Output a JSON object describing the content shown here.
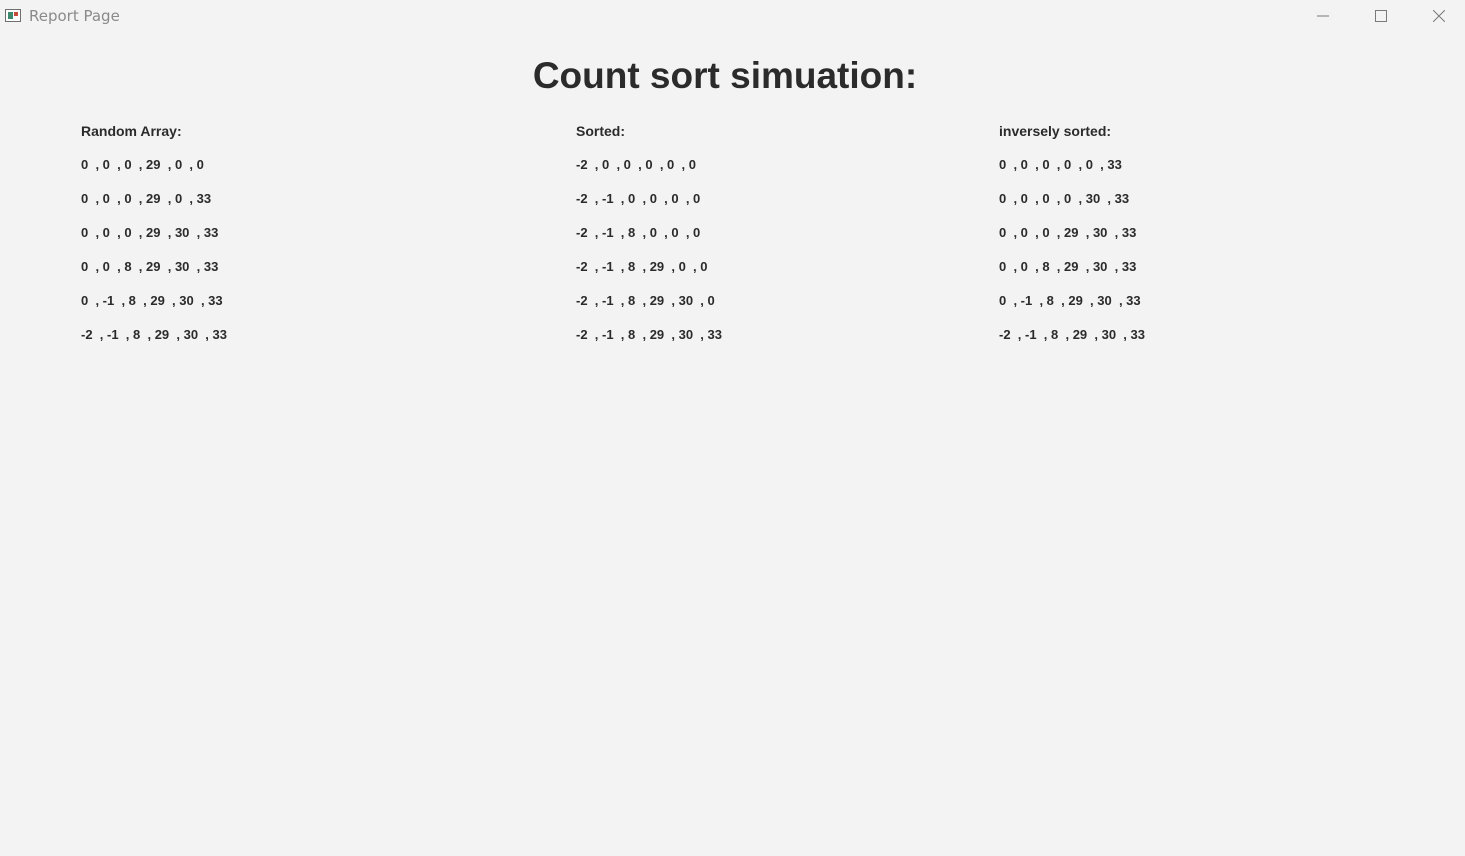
{
  "window": {
    "title": "Report Page",
    "app_icon": "application-window-icon",
    "controls": {
      "minimize_icon": "minimize-icon",
      "maximize_icon": "maximize-icon",
      "close_icon": "close-icon"
    }
  },
  "main": {
    "heading": "Count sort simuation:",
    "columns": [
      {
        "label": "Random Array:",
        "rows": [
          "0  , 0  , 0  , 29  , 0  , 0",
          "0  , 0  , 0  , 29  , 0  , 33",
          "0  , 0  , 0  , 29  , 30  , 33",
          "0  , 0  , 8  , 29  , 30  , 33",
          "0  , -1  , 8  , 29  , 30  , 33",
          "-2  , -1  , 8  , 29  , 30  , 33"
        ]
      },
      {
        "label": "Sorted:",
        "rows": [
          "-2  , 0  , 0  , 0  , 0  , 0",
          "-2  , -1  , 0  , 0  , 0  , 0",
          "-2  , -1  , 8  , 0  , 0  , 0",
          "-2  , -1  , 8  , 29  , 0  , 0",
          "-2  , -1  , 8  , 29  , 30  , 0",
          "-2  , -1  , 8  , 29  , 30  , 33"
        ]
      },
      {
        "label": "inversely sorted:",
        "rows": [
          "0  , 0  , 0  , 0  , 0  , 33",
          "0  , 0  , 0  , 0  , 30  , 33",
          "0  , 0  , 0  , 29  , 30  , 33",
          "0  , 0  , 8  , 29  , 30  , 33",
          "0  , -1  , 8  , 29  , 30  , 33",
          "-2  , -1  , 8  , 29  , 30  , 33"
        ]
      }
    ]
  }
}
